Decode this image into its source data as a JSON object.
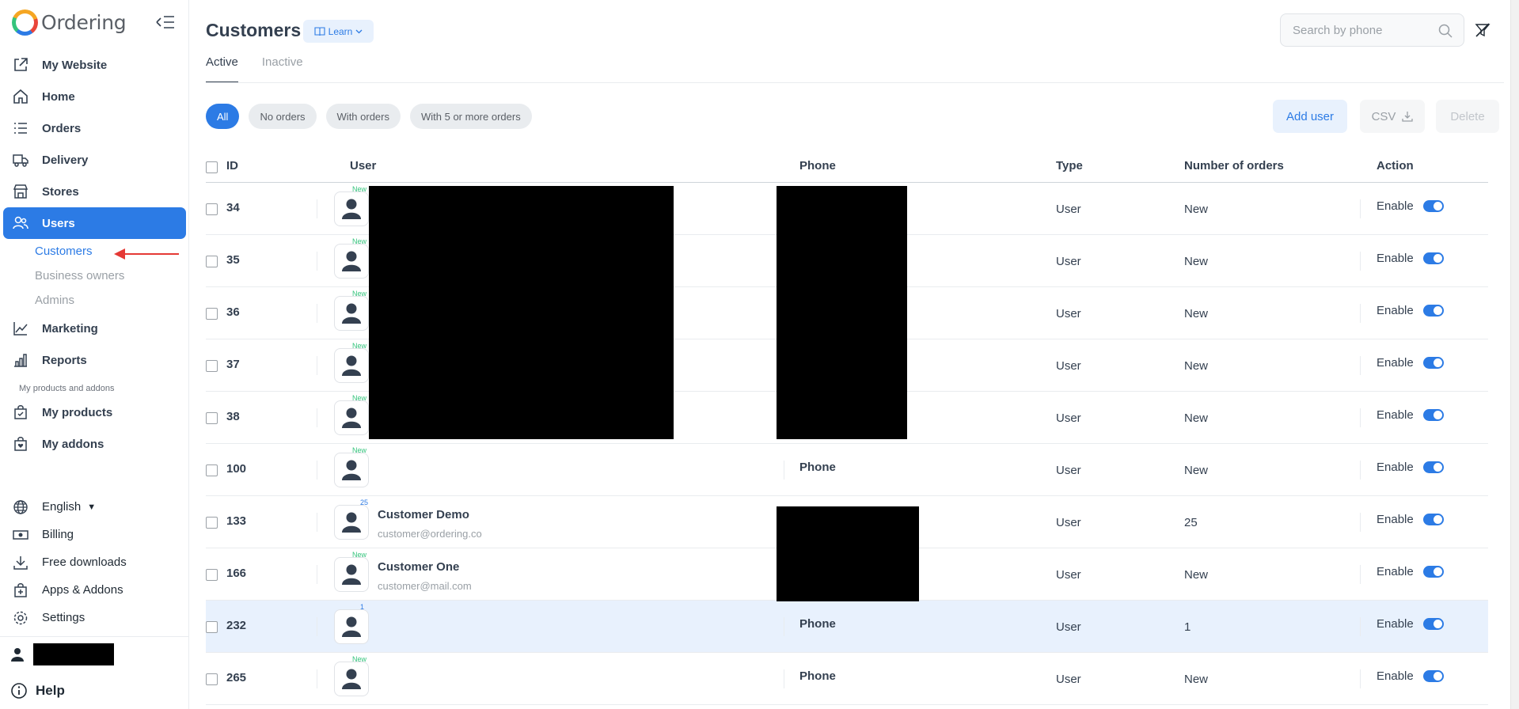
{
  "brand": {
    "name": "Ordering"
  },
  "sidebar": {
    "items": [
      {
        "label": "My Website",
        "icon": "external-link-icon"
      },
      {
        "label": "Home",
        "icon": "home-icon"
      },
      {
        "label": "Orders",
        "icon": "list-icon"
      },
      {
        "label": "Delivery",
        "icon": "truck-icon"
      },
      {
        "label": "Stores",
        "icon": "shop-icon"
      },
      {
        "label": "Users",
        "icon": "users-icon",
        "active": true
      },
      {
        "label": "Marketing",
        "icon": "graph-icon"
      },
      {
        "label": "Reports",
        "icon": "bar-chart-icon"
      },
      {
        "label": "My products",
        "icon": "bag-check-icon"
      },
      {
        "label": "My addons",
        "icon": "bag-heart-icon"
      }
    ],
    "users_sub": [
      {
        "label": "Customers",
        "active": true
      },
      {
        "label": "Business owners"
      },
      {
        "label": "Admins"
      }
    ],
    "section_title": "My products and addons",
    "bottom": [
      {
        "label": "English",
        "icon": "globe-icon"
      },
      {
        "label": "Billing",
        "icon": "cash-icon"
      },
      {
        "label": "Free downloads",
        "icon": "download-icon"
      },
      {
        "label": "Apps & Addons",
        "icon": "bag-plus-icon"
      },
      {
        "label": "Settings",
        "icon": "gear-icon"
      }
    ],
    "help": "Help"
  },
  "header": {
    "title": "Customers",
    "learn": "Learn",
    "search_placeholder": "Search by phone"
  },
  "tabs": [
    "Active",
    "Inactive"
  ],
  "filters": [
    "All",
    "No orders",
    "With orders",
    "With 5 or more orders"
  ],
  "actions": {
    "add_user": "Add user",
    "csv": "CSV",
    "delete": "Delete"
  },
  "table": {
    "columns": [
      "ID",
      "User",
      "Phone",
      "Type",
      "Number of orders",
      "Action"
    ],
    "rows": [
      {
        "id": "34",
        "badge": "New",
        "name": "",
        "email": "",
        "phone": "",
        "type": "User",
        "orders": "New",
        "action": "Enable",
        "enabled": true
      },
      {
        "id": "35",
        "badge": "New",
        "name": "",
        "email": "",
        "phone": "",
        "type": "User",
        "orders": "New",
        "action": "Enable",
        "enabled": true
      },
      {
        "id": "36",
        "badge": "New",
        "name": "",
        "email": "",
        "phone": "",
        "type": "User",
        "orders": "New",
        "action": "Enable",
        "enabled": true
      },
      {
        "id": "37",
        "badge": "New",
        "name": "",
        "email": "",
        "phone": "",
        "type": "User",
        "orders": "New",
        "action": "Enable",
        "enabled": true
      },
      {
        "id": "38",
        "badge": "New",
        "name": "",
        "email": "",
        "phone": "",
        "type": "User",
        "orders": "New",
        "action": "Enable",
        "enabled": true
      },
      {
        "id": "100",
        "badge": "New",
        "name": "",
        "email": "",
        "phone": "Phone",
        "type": "User",
        "orders": "New",
        "action": "Enable",
        "enabled": true
      },
      {
        "id": "133",
        "badge": "25",
        "name": "Customer Demo",
        "email": "customer@ordering.co",
        "phone": "",
        "type": "User",
        "orders": "25",
        "action": "Enable",
        "enabled": true
      },
      {
        "id": "166",
        "badge": "New",
        "name": "Customer One",
        "email": "customer@mail.com",
        "phone": "",
        "type": "User",
        "orders": "New",
        "action": "Enable",
        "enabled": true
      },
      {
        "id": "232",
        "badge": "1",
        "name": "",
        "email": "",
        "phone": "Phone",
        "type": "User",
        "orders": "1",
        "action": "Enable",
        "enabled": true,
        "highlight": true
      },
      {
        "id": "265",
        "badge": "New",
        "name": "",
        "email": "",
        "phone": "Phone",
        "type": "User",
        "orders": "New",
        "action": "Enable",
        "enabled": true
      }
    ]
  },
  "colors": {
    "accent": "#2c7be5",
    "new_badge": "#34c47c",
    "annotation_arrow": "#e53935"
  }
}
